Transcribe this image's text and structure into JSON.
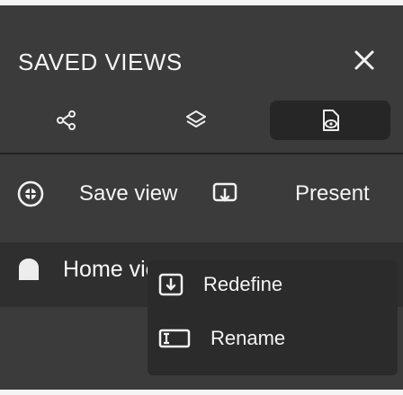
{
  "header": {
    "title": "SAVED VIEWS"
  },
  "tabs": [
    {
      "icon": "share-nodes-icon"
    },
    {
      "icon": "layers-icon"
    },
    {
      "icon": "saved-view-icon",
      "selected": true
    }
  ],
  "actions": {
    "save_label": "Save view",
    "present_label": "Present"
  },
  "views": [
    {
      "label": "Home view"
    }
  ],
  "context_menu": {
    "items": [
      {
        "label": "Redefine",
        "icon": "download-frame-icon"
      },
      {
        "label": "Rename",
        "icon": "rename-icon"
      }
    ]
  },
  "colors": {
    "background": "#3b3b3b",
    "selected_tab": "#262626",
    "menu": "#2b2b2b"
  }
}
